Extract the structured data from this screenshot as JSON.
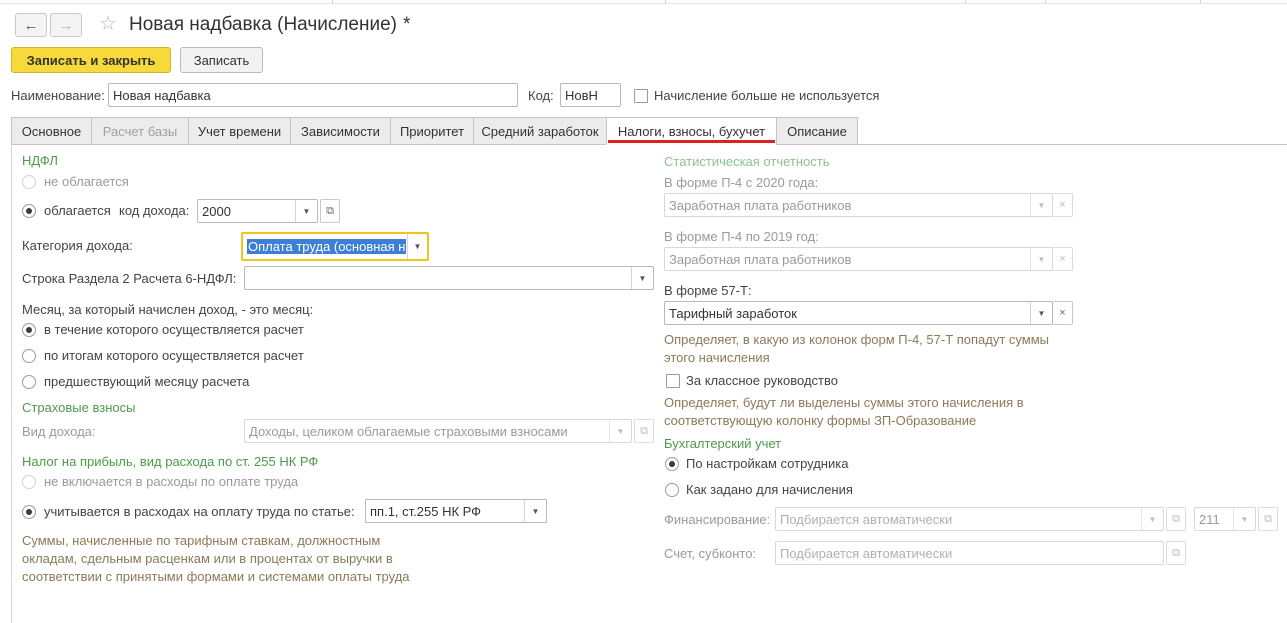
{
  "window": {
    "title": "Новая надбавка (Начисление)",
    "modified_marker": "*"
  },
  "toolbar": {
    "save_close_label": "Записать и закрыть",
    "save_label": "Записать"
  },
  "header": {
    "name_label": "Наименование:",
    "name_value": "Новая надбавка",
    "code_label": "Код:",
    "code_value": "НовН",
    "unused_label": "Начисление больше не используется"
  },
  "tabs": [
    {
      "label": "Основное"
    },
    {
      "label": "Расчет базы"
    },
    {
      "label": "Учет времени"
    },
    {
      "label": "Зависимости"
    },
    {
      "label": "Приоритет"
    },
    {
      "label": "Средний заработок"
    },
    {
      "label": "Налоги, взносы, бухучет"
    },
    {
      "label": "Описание"
    }
  ],
  "ndfl": {
    "section_title": "НДФЛ",
    "not_taxed_label": "не облагается",
    "taxed_label": "облагается",
    "income_code_label": "код дохода:",
    "income_code_value": "2000",
    "income_category_label": "Категория дохода:",
    "income_category_value": "Оплата труда (основная н",
    "row_6ndfl_label": "Строка Раздела 2 Расчета 6-НДФЛ:",
    "row_6ndfl_value": "",
    "month_question": "Месяц, за который начислен доход, - это месяц:",
    "month_options": [
      "в течение которого осуществляется расчет",
      "по итогам которого осуществляется расчет",
      "предшествующий месяцу расчета"
    ]
  },
  "insurance": {
    "section_title": "Страховые взносы",
    "income_type_label": "Вид дохода:",
    "income_type_value": "Доходы, целиком облагаемые страховыми взносами"
  },
  "profit_tax": {
    "section_title": "Налог на прибыль, вид расхода по ст. 255 НК РФ",
    "not_included_label": "не включается в расходы по оплате труда",
    "included_label": "учитывается в расходах на оплату труда по статье:",
    "article_value": "пп.1, ст.255 НК РФ",
    "note": "Суммы, начисленные по тарифным ставкам, должностным окладам, сдельным расценкам или в процентах от выручки в соответствии с принятыми формами и системами оплаты труда"
  },
  "statistics": {
    "section_title": "Статистическая отчетность",
    "p4_2020_label": "В форме П-4 с 2020 года:",
    "p4_2020_value": "Заработная плата работников",
    "p4_2019_label": "В форме П-4 по 2019 год:",
    "p4_2019_value": "Заработная плата работников",
    "f57t_label": "В форме 57-Т:",
    "f57t_value": "Тарифный заработок",
    "forms_note": "Определяет, в какую из колонок форм П-4, 57-Т попадут суммы этого начисления",
    "class_guidance_label": "За классное руководство",
    "class_note": "Определяет, будут ли выделены суммы этого начисления в соответствующую колонку формы ЗП-Образование"
  },
  "accounting": {
    "section_title": "Бухгалтерский учет",
    "by_employee_label": "По настройкам сотрудника",
    "as_set_label": "Как задано для начисления",
    "financing_label": "Финансирование:",
    "financing_placeholder": "Подбирается автоматически",
    "account_number": "211",
    "account_label": "Счет, субконто:",
    "account_placeholder": "Подбирается автоматически"
  },
  "colors": {
    "primary_button": "#f7d93c",
    "section_title": "#4d9b49",
    "note_text": "#8a7a58",
    "active_tab_underline": "#dd2020",
    "focus_border": "#f0c419"
  }
}
